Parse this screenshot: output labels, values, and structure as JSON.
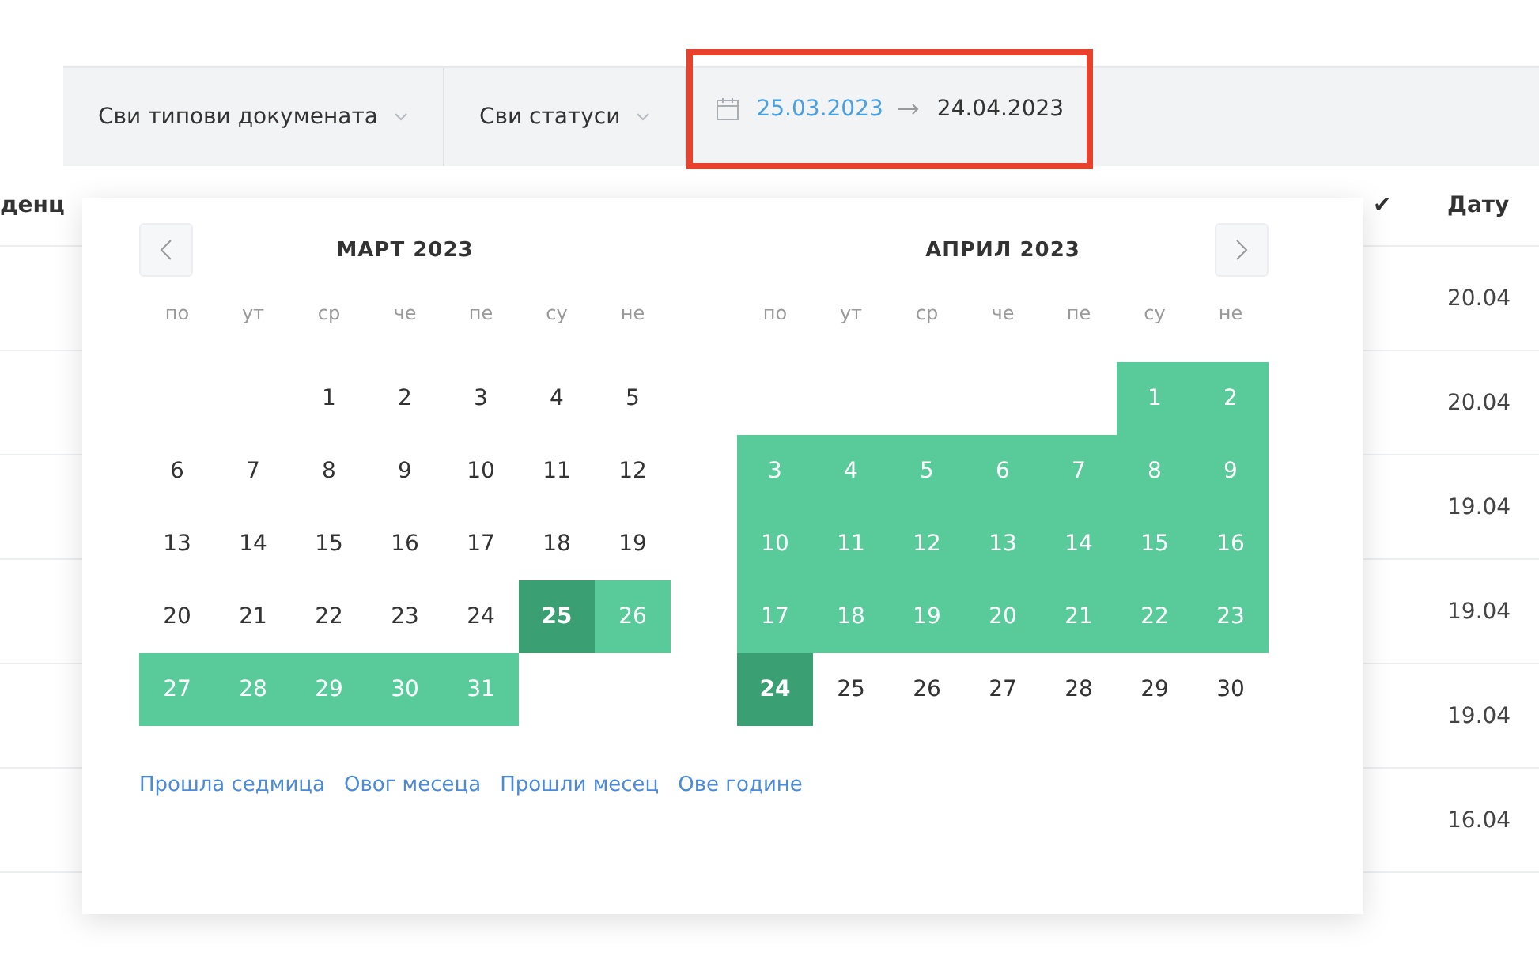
{
  "filter_bar": {
    "document_type": {
      "label": "Сви типови докумената"
    },
    "status": {
      "label": "Сви статуси"
    },
    "date_range": {
      "start": "25.03.2023",
      "end": "24.04.2023",
      "start_active": true,
      "highlighted": true
    }
  },
  "table": {
    "columns": [
      {
        "label": "денц"
      },
      {
        "label": "✔"
      },
      {
        "label": "Дату"
      }
    ],
    "rows": [
      {
        "column_3": "20.04"
      },
      {
        "column_3": "20.04"
      },
      {
        "column_3": "19.04"
      },
      {
        "column_3": "19.04"
      },
      {
        "column_3": "19.04"
      },
      {
        "column_3": "16.04"
      }
    ]
  },
  "date_picker": {
    "months": [
      {
        "title": "МАРТ 2023",
        "weekdays": [
          "по",
          "ут",
          "ср",
          "че",
          "пе",
          "су",
          "не"
        ],
        "days": [
          {
            "kind": "blank"
          },
          {
            "kind": "blank"
          },
          {
            "kind": "day",
            "day": "1",
            "selected": false,
            "endpoint": false
          },
          {
            "kind": "day",
            "day": "2",
            "selected": false,
            "endpoint": false
          },
          {
            "kind": "day",
            "day": "3",
            "selected": false,
            "endpoint": false
          },
          {
            "kind": "day",
            "day": "4",
            "selected": false,
            "endpoint": false
          },
          {
            "kind": "day",
            "day": "5",
            "selected": false,
            "endpoint": false
          },
          {
            "kind": "day",
            "day": "6",
            "selected": false,
            "endpoint": false
          },
          {
            "kind": "day",
            "day": "7",
            "selected": false,
            "endpoint": false
          },
          {
            "kind": "day",
            "day": "8",
            "selected": false,
            "endpoint": false
          },
          {
            "kind": "day",
            "day": "9",
            "selected": false,
            "endpoint": false
          },
          {
            "kind": "day",
            "day": "10",
            "selected": false,
            "endpoint": false
          },
          {
            "kind": "day",
            "day": "11",
            "selected": false,
            "endpoint": false
          },
          {
            "kind": "day",
            "day": "12",
            "selected": false,
            "endpoint": false
          },
          {
            "kind": "day",
            "day": "13",
            "selected": false,
            "endpoint": false
          },
          {
            "kind": "day",
            "day": "14",
            "selected": false,
            "endpoint": false
          },
          {
            "kind": "day",
            "day": "15",
            "selected": false,
            "endpoint": false
          },
          {
            "kind": "day",
            "day": "16",
            "selected": false,
            "endpoint": false
          },
          {
            "kind": "day",
            "day": "17",
            "selected": false,
            "endpoint": false
          },
          {
            "kind": "day",
            "day": "18",
            "selected": false,
            "endpoint": false
          },
          {
            "kind": "day",
            "day": "19",
            "selected": false,
            "endpoint": false
          },
          {
            "kind": "day",
            "day": "20",
            "selected": false,
            "endpoint": false
          },
          {
            "kind": "day",
            "day": "21",
            "selected": false,
            "endpoint": false
          },
          {
            "kind": "day",
            "day": "22",
            "selected": false,
            "endpoint": false
          },
          {
            "kind": "day",
            "day": "23",
            "selected": false,
            "endpoint": false
          },
          {
            "kind": "day",
            "day": "24",
            "selected": false,
            "endpoint": false
          },
          {
            "kind": "day",
            "day": "25",
            "selected": true,
            "endpoint": true
          },
          {
            "kind": "day",
            "day": "26",
            "selected": true,
            "endpoint": false
          },
          {
            "kind": "day",
            "day": "27",
            "selected": true,
            "endpoint": false
          },
          {
            "kind": "day",
            "day": "28",
            "selected": true,
            "endpoint": false
          },
          {
            "kind": "day",
            "day": "29",
            "selected": true,
            "endpoint": false
          },
          {
            "kind": "day",
            "day": "30",
            "selected": true,
            "endpoint": false
          },
          {
            "kind": "day",
            "day": "31",
            "selected": true,
            "endpoint": false
          }
        ]
      },
      {
        "title": "АПРИЛ 2023",
        "weekdays": [
          "по",
          "ут",
          "ср",
          "че",
          "пе",
          "су",
          "не"
        ],
        "days": [
          {
            "kind": "blank"
          },
          {
            "kind": "blank"
          },
          {
            "kind": "blank"
          },
          {
            "kind": "blank"
          },
          {
            "kind": "blank"
          },
          {
            "kind": "day",
            "day": "1",
            "selected": true,
            "endpoint": false
          },
          {
            "kind": "day",
            "day": "2",
            "selected": true,
            "endpoint": false
          },
          {
            "kind": "day",
            "day": "3",
            "selected": true,
            "endpoint": false
          },
          {
            "kind": "day",
            "day": "4",
            "selected": true,
            "endpoint": false
          },
          {
            "kind": "day",
            "day": "5",
            "selected": true,
            "endpoint": false
          },
          {
            "kind": "day",
            "day": "6",
            "selected": true,
            "endpoint": false
          },
          {
            "kind": "day",
            "day": "7",
            "selected": true,
            "endpoint": false
          },
          {
            "kind": "day",
            "day": "8",
            "selected": true,
            "endpoint": false
          },
          {
            "kind": "day",
            "day": "9",
            "selected": true,
            "endpoint": false
          },
          {
            "kind": "day",
            "day": "10",
            "selected": true,
            "endpoint": false
          },
          {
            "kind": "day",
            "day": "11",
            "selected": true,
            "endpoint": false
          },
          {
            "kind": "day",
            "day": "12",
            "selected": true,
            "endpoint": false
          },
          {
            "kind": "day",
            "day": "13",
            "selected": true,
            "endpoint": false
          },
          {
            "kind": "day",
            "day": "14",
            "selected": true,
            "endpoint": false
          },
          {
            "kind": "day",
            "day": "15",
            "selected": true,
            "endpoint": false
          },
          {
            "kind": "day",
            "day": "16",
            "selected": true,
            "endpoint": false
          },
          {
            "kind": "day",
            "day": "17",
            "selected": true,
            "endpoint": false
          },
          {
            "kind": "day",
            "day": "18",
            "selected": true,
            "endpoint": false
          },
          {
            "kind": "day",
            "day": "19",
            "selected": true,
            "endpoint": false
          },
          {
            "kind": "day",
            "day": "20",
            "selected": true,
            "endpoint": false
          },
          {
            "kind": "day",
            "day": "21",
            "selected": true,
            "endpoint": false
          },
          {
            "kind": "day",
            "day": "22",
            "selected": true,
            "endpoint": false
          },
          {
            "kind": "day",
            "day": "23",
            "selected": true,
            "endpoint": false
          },
          {
            "kind": "day",
            "day": "24",
            "selected": true,
            "endpoint": true
          },
          {
            "kind": "day",
            "day": "25",
            "selected": false,
            "endpoint": false
          },
          {
            "kind": "day",
            "day": "26",
            "selected": false,
            "endpoint": false
          },
          {
            "kind": "day",
            "day": "27",
            "selected": false,
            "endpoint": false
          },
          {
            "kind": "day",
            "day": "28",
            "selected": false,
            "endpoint": false
          },
          {
            "kind": "day",
            "day": "29",
            "selected": false,
            "endpoint": false
          },
          {
            "kind": "day",
            "day": "30",
            "selected": false,
            "endpoint": false
          }
        ]
      }
    ],
    "presets": [
      "Прошла седмица",
      "Овог месеца",
      "Прошли месец",
      "Ове године"
    ]
  }
}
